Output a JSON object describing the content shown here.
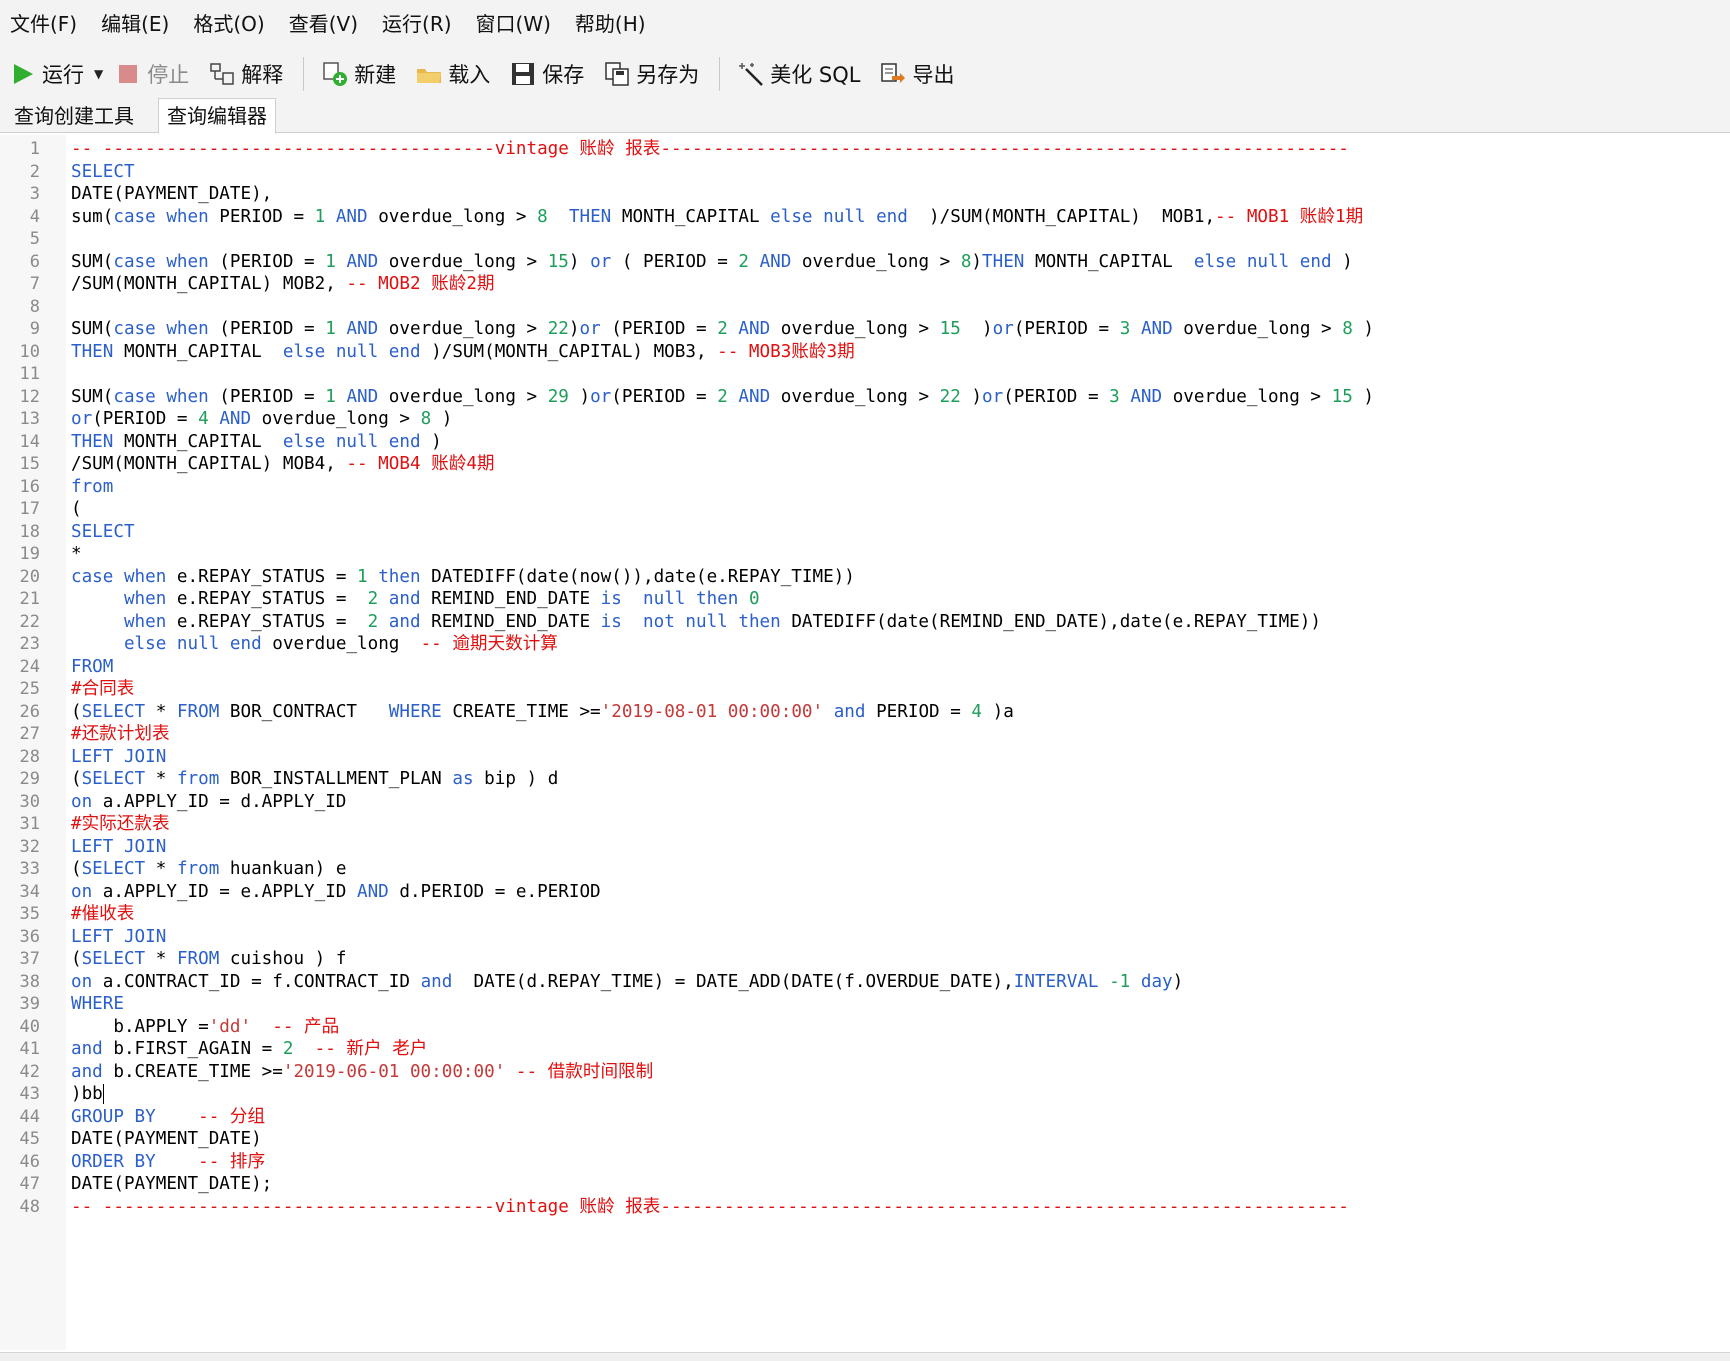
{
  "menu": [
    "文件(F)",
    "编辑(E)",
    "格式(O)",
    "查看(V)",
    "运行(R)",
    "窗口(W)",
    "帮助(H)"
  ],
  "toolbar": {
    "run": "运行",
    "stop": "停止",
    "explain": "解释",
    "new": "新建",
    "load": "载入",
    "save": "保存",
    "save_as": "另存为",
    "beautify": "美化 SQL",
    "export": "导出"
  },
  "tabs": [
    "查询创建工具",
    "查询编辑器"
  ],
  "colors": {
    "keyword": "#2b5fc9",
    "number": "#1d9e5a",
    "string": "#c43a3a",
    "comment": "#e01010"
  },
  "code_lines": [
    [
      [
        "cm",
        "-- -------------------------------------vintage 账龄 报表-----------------------------------------------------------------"
      ]
    ],
    [
      [
        "kw",
        "SELECT"
      ]
    ],
    [
      [
        "t",
        "DATE(PAYMENT_DATE),"
      ]
    ],
    [
      [
        "t",
        "sum("
      ],
      [
        "kw",
        "case when"
      ],
      [
        "t",
        " PERIOD = "
      ],
      [
        "num",
        "1"
      ],
      [
        "t",
        " "
      ],
      [
        "kw",
        "AND"
      ],
      [
        "t",
        " overdue_long > "
      ],
      [
        "num",
        "8"
      ],
      [
        "t",
        "  "
      ],
      [
        "kw",
        "THEN"
      ],
      [
        "t",
        " MONTH_CAPITAL "
      ],
      [
        "kw",
        "else null end"
      ],
      [
        "t",
        "  )/SUM(MONTH_CAPITAL)  MOB1,"
      ],
      [
        "cm",
        "-- MOB1 账龄1期"
      ]
    ],
    [],
    [
      [
        "t",
        "SUM("
      ],
      [
        "kw",
        "case when"
      ],
      [
        "t",
        " (PERIOD = "
      ],
      [
        "num",
        "1"
      ],
      [
        "t",
        " "
      ],
      [
        "kw",
        "AND"
      ],
      [
        "t",
        " overdue_long > "
      ],
      [
        "num",
        "15"
      ],
      [
        "t",
        ") "
      ],
      [
        "kw",
        "or"
      ],
      [
        "t",
        " ( PERIOD = "
      ],
      [
        "num",
        "2"
      ],
      [
        "t",
        " "
      ],
      [
        "kw",
        "AND"
      ],
      [
        "t",
        " overdue_long > "
      ],
      [
        "num",
        "8"
      ],
      [
        "t",
        ")"
      ],
      [
        "kw",
        "THEN"
      ],
      [
        "t",
        " MONTH_CAPITAL  "
      ],
      [
        "kw",
        "else null end"
      ],
      [
        "t",
        " )"
      ]
    ],
    [
      [
        "t",
        "/SUM(MONTH_CAPITAL) MOB2, "
      ],
      [
        "cm",
        "-- MOB2 账龄2期"
      ]
    ],
    [],
    [
      [
        "t",
        "SUM("
      ],
      [
        "kw",
        "case when"
      ],
      [
        "t",
        " (PERIOD = "
      ],
      [
        "num",
        "1"
      ],
      [
        "t",
        " "
      ],
      [
        "kw",
        "AND"
      ],
      [
        "t",
        " overdue_long > "
      ],
      [
        "num",
        "22"
      ],
      [
        "t",
        ")"
      ],
      [
        "kw",
        "or"
      ],
      [
        "t",
        " (PERIOD = "
      ],
      [
        "num",
        "2"
      ],
      [
        "t",
        " "
      ],
      [
        "kw",
        "AND"
      ],
      [
        "t",
        " overdue_long > "
      ],
      [
        "num",
        "15"
      ],
      [
        "t",
        "  )"
      ],
      [
        "kw",
        "or"
      ],
      [
        "t",
        "(PERIOD = "
      ],
      [
        "num",
        "3"
      ],
      [
        "t",
        " "
      ],
      [
        "kw",
        "AND"
      ],
      [
        "t",
        " overdue_long > "
      ],
      [
        "num",
        "8"
      ],
      [
        "t",
        " )"
      ]
    ],
    [
      [
        "kw",
        "THEN"
      ],
      [
        "t",
        " MONTH_CAPITAL  "
      ],
      [
        "kw",
        "else null end"
      ],
      [
        "t",
        " )/SUM(MONTH_CAPITAL) MOB3, "
      ],
      [
        "cm",
        "-- MOB3账龄3期"
      ]
    ],
    [],
    [
      [
        "t",
        "SUM("
      ],
      [
        "kw",
        "case when"
      ],
      [
        "t",
        " (PERIOD = "
      ],
      [
        "num",
        "1"
      ],
      [
        "t",
        " "
      ],
      [
        "kw",
        "AND"
      ],
      [
        "t",
        " overdue_long > "
      ],
      [
        "num",
        "29"
      ],
      [
        "t",
        " )"
      ],
      [
        "kw",
        "or"
      ],
      [
        "t",
        "(PERIOD = "
      ],
      [
        "num",
        "2"
      ],
      [
        "t",
        " "
      ],
      [
        "kw",
        "AND"
      ],
      [
        "t",
        " overdue_long > "
      ],
      [
        "num",
        "22"
      ],
      [
        "t",
        " )"
      ],
      [
        "kw",
        "or"
      ],
      [
        "t",
        "(PERIOD = "
      ],
      [
        "num",
        "3"
      ],
      [
        "t",
        " "
      ],
      [
        "kw",
        "AND"
      ],
      [
        "t",
        " overdue_long > "
      ],
      [
        "num",
        "15"
      ],
      [
        "t",
        " )"
      ]
    ],
    [
      [
        "kw",
        "or"
      ],
      [
        "t",
        "(PERIOD = "
      ],
      [
        "num",
        "4"
      ],
      [
        "t",
        " "
      ],
      [
        "kw",
        "AND"
      ],
      [
        "t",
        " overdue_long > "
      ],
      [
        "num",
        "8"
      ],
      [
        "t",
        " )"
      ]
    ],
    [
      [
        "kw",
        "THEN"
      ],
      [
        "t",
        " MONTH_CAPITAL  "
      ],
      [
        "kw",
        "else null end"
      ],
      [
        "t",
        " )"
      ]
    ],
    [
      [
        "t",
        "/SUM(MONTH_CAPITAL) MOB4, "
      ],
      [
        "cm",
        "-- MOB4 账龄4期"
      ]
    ],
    [
      [
        "kw",
        "from"
      ]
    ],
    [
      [
        "t",
        "("
      ]
    ],
    [
      [
        "kw",
        "SELECT"
      ]
    ],
    [
      [
        "t",
        "*"
      ]
    ],
    [
      [
        "kw",
        "case when"
      ],
      [
        "t",
        " e.REPAY_STATUS = "
      ],
      [
        "num",
        "1"
      ],
      [
        "t",
        " "
      ],
      [
        "kw",
        "then"
      ],
      [
        "t",
        " DATEDIFF(date(now()),date(e.REPAY_TIME))"
      ]
    ],
    [
      [
        "t",
        "     "
      ],
      [
        "kw",
        "when"
      ],
      [
        "t",
        " e.REPAY_STATUS =  "
      ],
      [
        "num",
        "2"
      ],
      [
        "t",
        " "
      ],
      [
        "kw",
        "and"
      ],
      [
        "t",
        " REMIND_END_DATE "
      ],
      [
        "kw",
        "is"
      ],
      [
        "t",
        "  "
      ],
      [
        "kw",
        "null then"
      ],
      [
        "t",
        " "
      ],
      [
        "num",
        "0"
      ]
    ],
    [
      [
        "t",
        "     "
      ],
      [
        "kw",
        "when"
      ],
      [
        "t",
        " e.REPAY_STATUS =  "
      ],
      [
        "num",
        "2"
      ],
      [
        "t",
        " "
      ],
      [
        "kw",
        "and"
      ],
      [
        "t",
        " REMIND_END_DATE "
      ],
      [
        "kw",
        "is"
      ],
      [
        "t",
        "  "
      ],
      [
        "kw",
        "not null then"
      ],
      [
        "t",
        " DATEDIFF(date(REMIND_END_DATE),date(e.REPAY_TIME))"
      ]
    ],
    [
      [
        "t",
        "     "
      ],
      [
        "kw",
        "else null end"
      ],
      [
        "t",
        " overdue_long  "
      ],
      [
        "cm",
        "-- 逾期天数计算"
      ]
    ],
    [
      [
        "kw",
        "FROM"
      ]
    ],
    [
      [
        "cm",
        "#合同表"
      ]
    ],
    [
      [
        "t",
        "("
      ],
      [
        "kw",
        "SELECT"
      ],
      [
        "t",
        " * "
      ],
      [
        "kw",
        "FROM"
      ],
      [
        "t",
        " BOR_CONTRACT   "
      ],
      [
        "kw",
        "WHERE"
      ],
      [
        "t",
        " CREATE_TIME >="
      ],
      [
        "str",
        "'2019-08-01 00:00:00'"
      ],
      [
        "t",
        " "
      ],
      [
        "kw",
        "and"
      ],
      [
        "t",
        " PERIOD = "
      ],
      [
        "num",
        "4"
      ],
      [
        "t",
        " )a"
      ]
    ],
    [
      [
        "cm",
        "#还款计划表"
      ]
    ],
    [
      [
        "kw",
        "LEFT JOIN"
      ]
    ],
    [
      [
        "t",
        "("
      ],
      [
        "kw",
        "SELECT"
      ],
      [
        "t",
        " * "
      ],
      [
        "kw",
        "from"
      ],
      [
        "t",
        " BOR_INSTALLMENT_PLAN "
      ],
      [
        "kw",
        "as"
      ],
      [
        "t",
        " bip ) d"
      ]
    ],
    [
      [
        "kw",
        "on"
      ],
      [
        "t",
        " a.APPLY_ID = d.APPLY_ID"
      ]
    ],
    [
      [
        "cm",
        "#实际还款表"
      ]
    ],
    [
      [
        "kw",
        "LEFT JOIN"
      ]
    ],
    [
      [
        "t",
        "("
      ],
      [
        "kw",
        "SELECT"
      ],
      [
        "t",
        " * "
      ],
      [
        "kw",
        "from"
      ],
      [
        "t",
        " huankuan) e"
      ]
    ],
    [
      [
        "kw",
        "on"
      ],
      [
        "t",
        " a.APPLY_ID = e.APPLY_ID "
      ],
      [
        "kw",
        "AND"
      ],
      [
        "t",
        " d.PERIOD = e.PERIOD"
      ]
    ],
    [
      [
        "cm",
        "#催收表"
      ]
    ],
    [
      [
        "kw",
        "LEFT JOIN"
      ]
    ],
    [
      [
        "t",
        "("
      ],
      [
        "kw",
        "SELECT"
      ],
      [
        "t",
        " * "
      ],
      [
        "kw",
        "FROM"
      ],
      [
        "t",
        " cuishou ) f"
      ]
    ],
    [
      [
        "kw",
        "on"
      ],
      [
        "t",
        " a.CONTRACT_ID = f.CONTRACT_ID "
      ],
      [
        "kw",
        "and"
      ],
      [
        "t",
        "  DATE(d.REPAY_TIME) = DATE_ADD(DATE(f.OVERDUE_DATE),"
      ],
      [
        "kw",
        "INTERVAL"
      ],
      [
        "t",
        " "
      ],
      [
        "num",
        "-1"
      ],
      [
        "t",
        " "
      ],
      [
        "kw",
        "day"
      ],
      [
        "t",
        ")"
      ]
    ],
    [
      [
        "kw",
        "WHERE"
      ]
    ],
    [
      [
        "t",
        "    b.APPLY ="
      ],
      [
        "str",
        "'dd'"
      ],
      [
        "t",
        "  "
      ],
      [
        "cm",
        "-- 产品"
      ]
    ],
    [
      [
        "kw",
        "and"
      ],
      [
        "t",
        " b.FIRST_AGAIN = "
      ],
      [
        "num",
        "2"
      ],
      [
        "t",
        "  "
      ],
      [
        "cm",
        "-- 新户 老户"
      ]
    ],
    [
      [
        "kw",
        "and"
      ],
      [
        "t",
        " b.CREATE_TIME >="
      ],
      [
        "str",
        "'2019-06-01 00:00:00'"
      ],
      [
        "t",
        " "
      ],
      [
        "cm",
        "-- 借款时间限制"
      ]
    ],
    [
      [
        "t",
        ")bb"
      ]
    ],
    [
      [
        "kw",
        "GROUP BY"
      ],
      [
        "t",
        "    "
      ],
      [
        "cm",
        "-- 分组"
      ]
    ],
    [
      [
        "t",
        "DATE(PAYMENT_DATE)"
      ]
    ],
    [
      [
        "kw",
        "ORDER BY"
      ],
      [
        "t",
        "    "
      ],
      [
        "cm",
        "-- 排序"
      ]
    ],
    [
      [
        "t",
        "DATE(PAYMENT_DATE);"
      ]
    ],
    [
      [
        "cm",
        "-- -------------------------------------vintage 账龄 报表-----------------------------------------------------------------"
      ]
    ]
  ]
}
